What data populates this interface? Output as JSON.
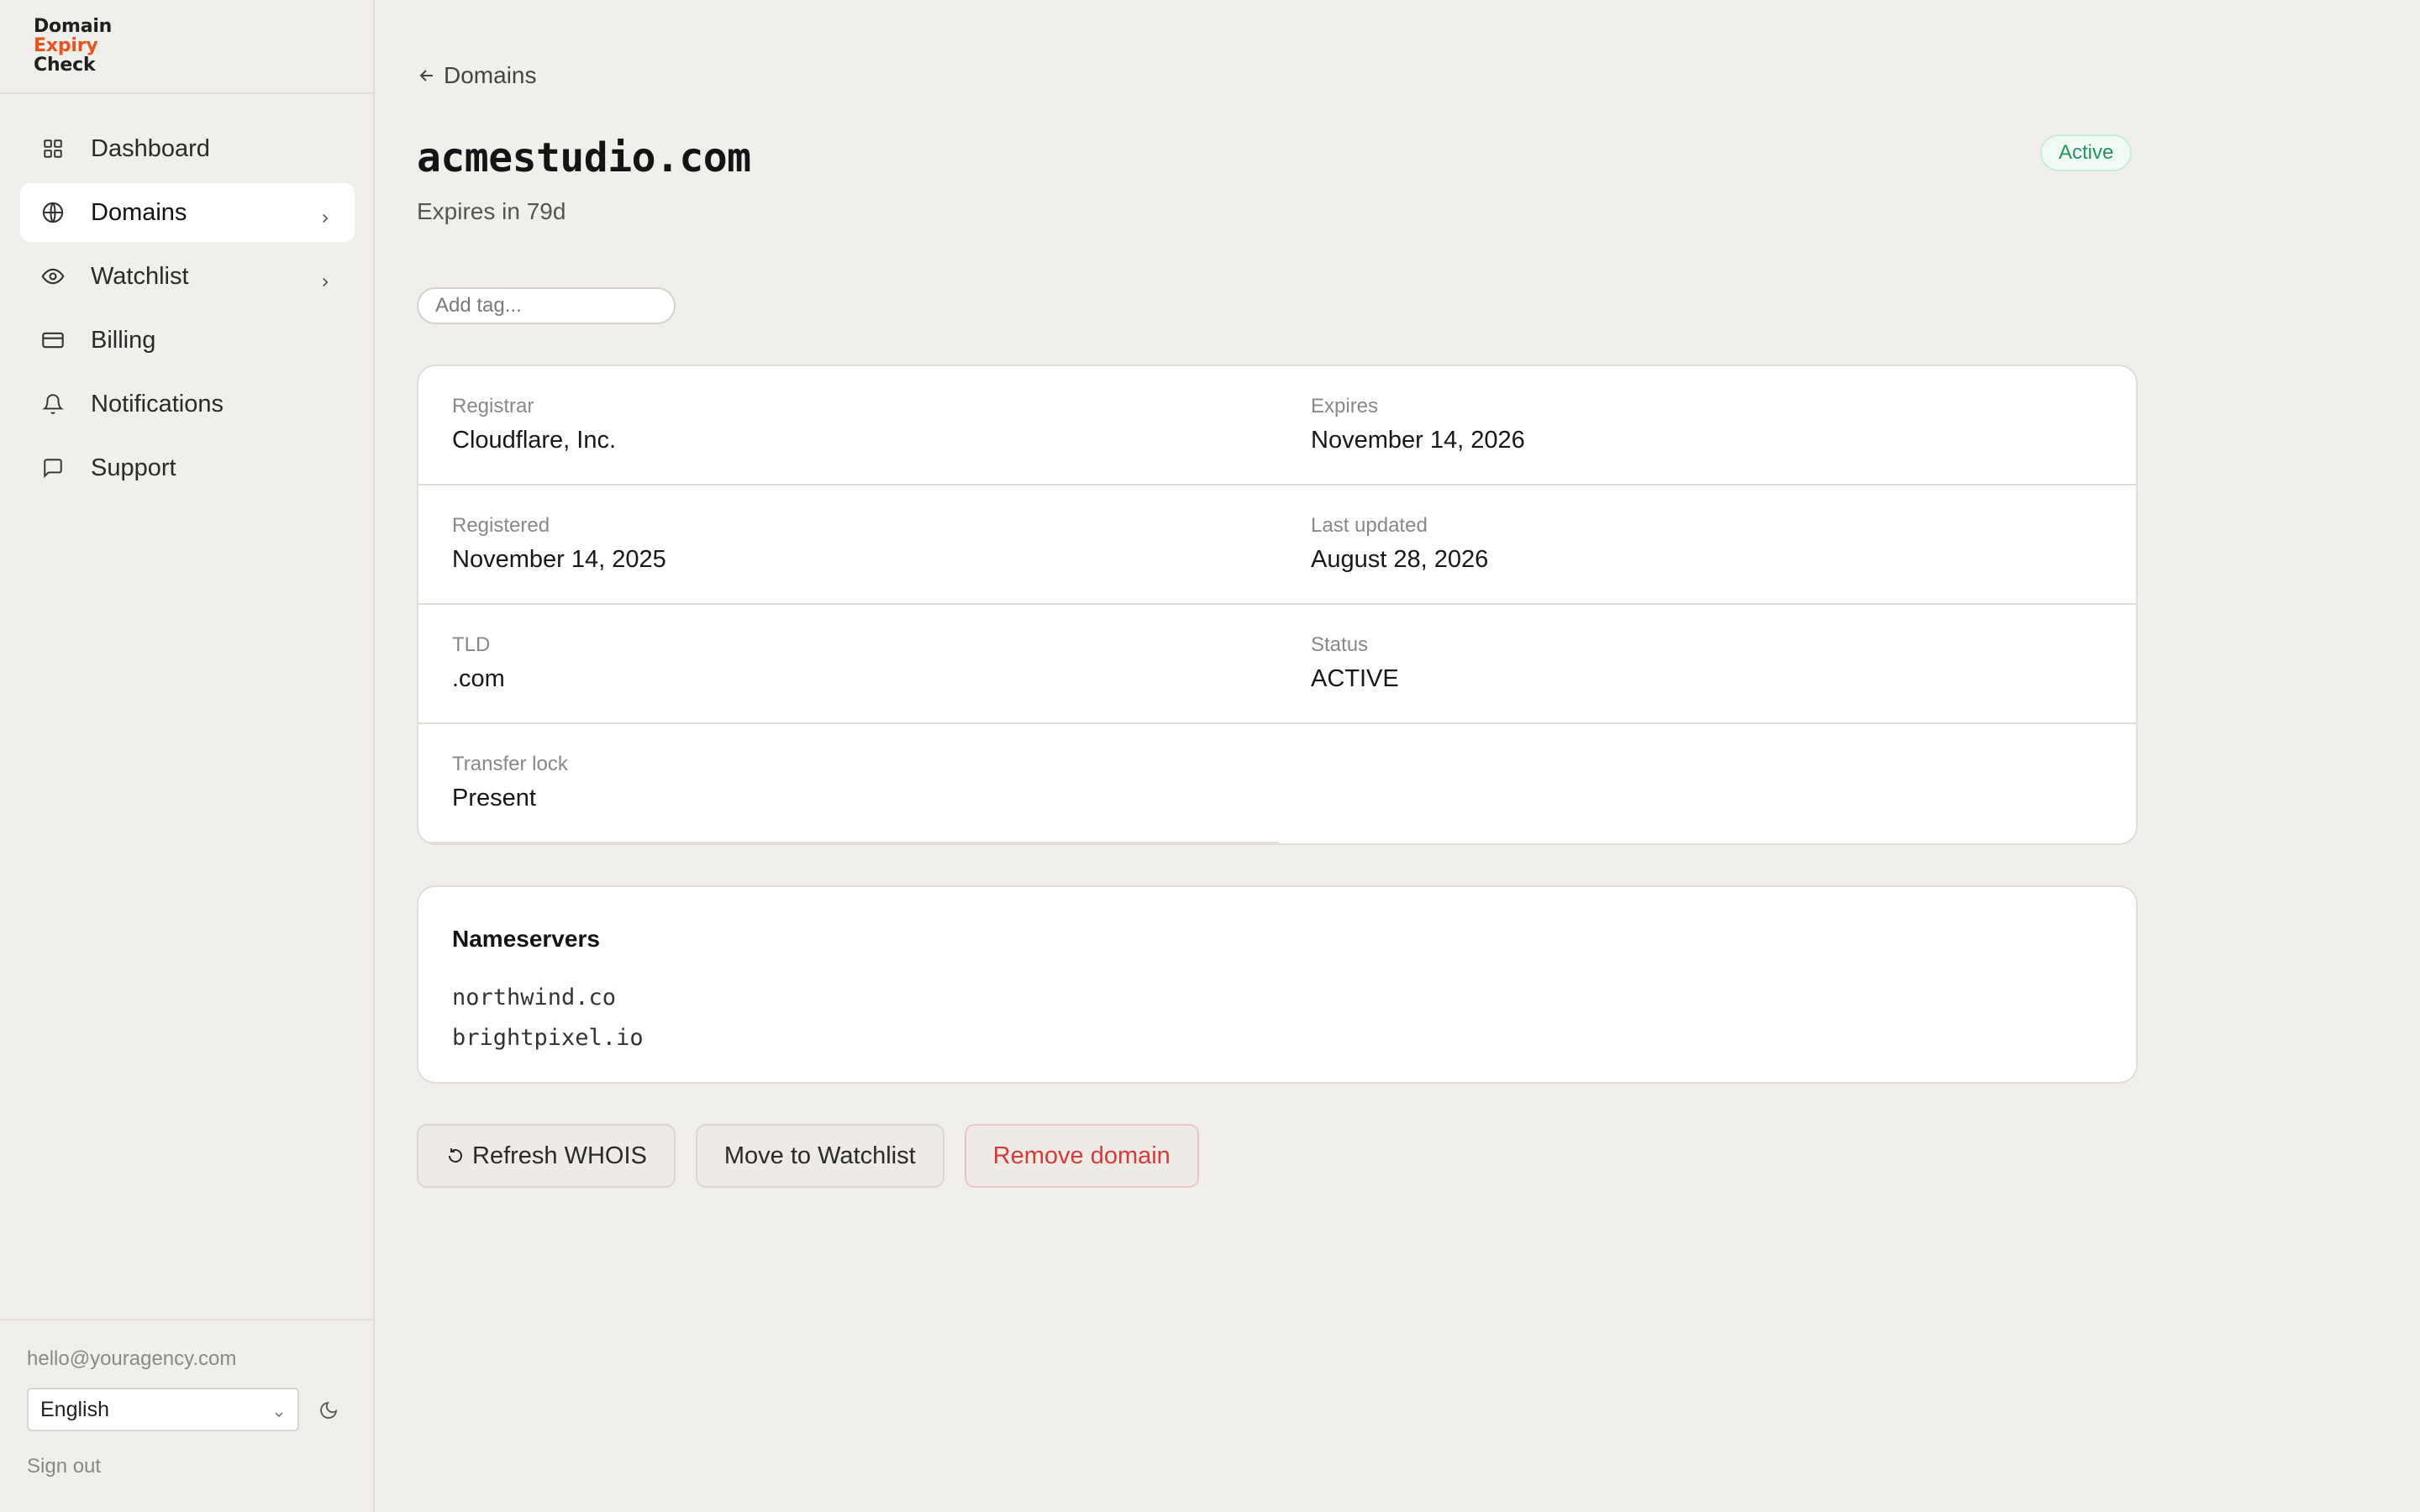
{
  "app": {
    "logo_line1": "Domain",
    "logo_line2": "Expiry",
    "logo_line3": "Check"
  },
  "sidebar": {
    "items": [
      {
        "label": "Dashboard",
        "icon": "grid-icon",
        "active": false,
        "has_chevron": false
      },
      {
        "label": "Domains",
        "icon": "globe-icon",
        "active": true,
        "has_chevron": true
      },
      {
        "label": "Watchlist",
        "icon": "eye-icon",
        "active": false,
        "has_chevron": true
      },
      {
        "label": "Billing",
        "icon": "credit-card-icon",
        "active": false,
        "has_chevron": false
      },
      {
        "label": "Notifications",
        "icon": "bell-icon",
        "active": false,
        "has_chevron": false
      },
      {
        "label": "Support",
        "icon": "message-icon",
        "active": false,
        "has_chevron": false
      }
    ],
    "footer": {
      "email": "hello@youragency.com",
      "language": "English",
      "sign_out": "Sign out"
    }
  },
  "header": {
    "back_label": "Domains",
    "title": "acmestudio.com",
    "subtitle": "Expires in 79d",
    "status_badge": "Active",
    "tag_placeholder": "Add tag..."
  },
  "details": {
    "registrar_label": "Registrar",
    "registrar_value": "Cloudflare, Inc.",
    "expires_label": "Expires",
    "expires_value": "November 14, 2026",
    "registered_label": "Registered",
    "registered_value": "November 14, 2025",
    "last_updated_label": "Last updated",
    "last_updated_value": "August 28, 2026",
    "tld_label": "TLD",
    "tld_value": ".com",
    "status_label": "Status",
    "status_value": "ACTIVE",
    "transfer_lock_label": "Transfer lock",
    "transfer_lock_value": "Present"
  },
  "nameservers": {
    "title": "Nameservers",
    "items": [
      "northwind.co",
      "brightpixel.io"
    ]
  },
  "actions": {
    "refresh_label": "Refresh WHOIS",
    "watchlist_label": "Move to Watchlist",
    "remove_label": "Remove domain"
  },
  "colors": {
    "background": "#f1efeb",
    "accent": "#e8531e",
    "success": "#26925c",
    "danger": "#d83a3a"
  }
}
